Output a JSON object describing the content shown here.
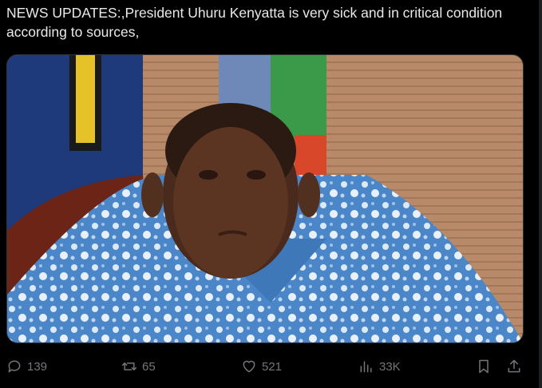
{
  "post": {
    "text": "NEWS UPDATES:,President Uhuru Kenyatta is very sick and in critical condition according to sources,"
  },
  "media": {
    "alt": "Photo of a man in a blue floral shirt in front of flags"
  },
  "actions": {
    "replies": "139",
    "reposts": "65",
    "likes": "521",
    "views": "33K"
  },
  "icons": {
    "reply": "reply-icon",
    "repost": "repost-icon",
    "like": "heart-icon",
    "views": "views-icon",
    "bookmark": "bookmark-icon",
    "share": "share-icon"
  },
  "colors": {
    "background": "#000000",
    "text": "#e7e9ea",
    "muted": "#71767b"
  }
}
